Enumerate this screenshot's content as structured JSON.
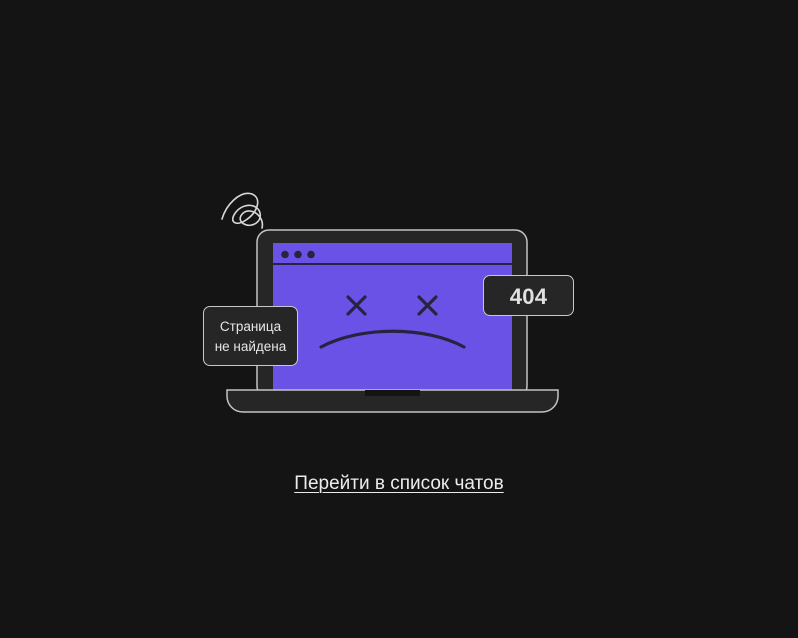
{
  "error": {
    "code": "404",
    "message_line1": "Страница",
    "message_line2": "не найдена"
  },
  "navigation": {
    "back_link_label": "Перейти в список чатов"
  },
  "illustration": {
    "icon": "sad-laptop-icon",
    "screen_color": "#6a52e6",
    "face_color": "#2a2340"
  }
}
